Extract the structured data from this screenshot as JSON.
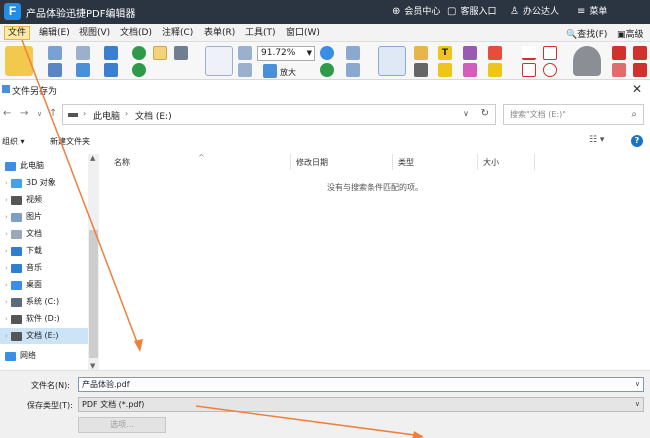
{
  "app": {
    "title": "产品体验迅捷PDF编辑器",
    "logo_letter": "F",
    "member_center": "会员中心",
    "feedback": "客服入口",
    "user": "办公达人",
    "menu": "菜单"
  },
  "menubar": {
    "items": [
      "文件",
      "编辑(E)",
      "视图(V)",
      "文档(D)",
      "注释(C)",
      "表单(R)",
      "工具(T)",
      "窗口(W)"
    ],
    "find": "查找(F)",
    "advanced": "高级搜"
  },
  "toolbar": {
    "zoom": "91.72%",
    "zoom_in_label": "放大"
  },
  "dialog": {
    "title": "文件另存为",
    "breadcrumb": [
      "此电脑",
      "文档 (E:)"
    ],
    "search_placeholder": "搜索\"文档 (E:)\"",
    "organize": "组织 ▾",
    "new_folder": "新建文件夹",
    "columns": [
      "名称",
      "修改日期",
      "类型",
      "大小"
    ],
    "empty_message": "没有与搜索条件匹配的项。",
    "nav_tree": [
      {
        "label": "此电脑",
        "icon": "computer-icon",
        "color": "#3a8ee6",
        "root": true
      },
      {
        "label": "3D 对象",
        "icon": "3d-objects-icon",
        "color": "#44a0e8"
      },
      {
        "label": "视频",
        "icon": "video-icon",
        "color": "#555555"
      },
      {
        "label": "图片",
        "icon": "pictures-icon",
        "color": "#7aa0c8"
      },
      {
        "label": "文档",
        "icon": "documents-icon",
        "color": "#9aa8b8"
      },
      {
        "label": "下载",
        "icon": "download-icon",
        "color": "#2f7fd0"
      },
      {
        "label": "音乐",
        "icon": "music-icon",
        "color": "#2f7fd0"
      },
      {
        "label": "桌面",
        "icon": "desktop-icon",
        "color": "#3a8ee6"
      },
      {
        "label": "系统 (C:)",
        "icon": "system-drive-icon",
        "color": "#5b6b7b"
      },
      {
        "label": "软件 (D:)",
        "icon": "drive-icon",
        "color": "#555555"
      },
      {
        "label": "文档 (E:)",
        "icon": "drive-icon",
        "color": "#555555",
        "selected": true
      },
      {
        "label": "网络",
        "icon": "network-icon",
        "color": "#3a8ee6",
        "root": true
      }
    ],
    "filename_label": "文件名(N):",
    "filename_value": "产品体验.pdf",
    "filetype_label": "保存类型(T):",
    "filetype_value": "PDF 文档 (*.pdf)",
    "select_button": "选项..."
  },
  "colors": {
    "titlebar": "#2b3441",
    "accent": "#1f8ee8",
    "arrow": "#f07f3c",
    "selection": "#cce4f7"
  }
}
